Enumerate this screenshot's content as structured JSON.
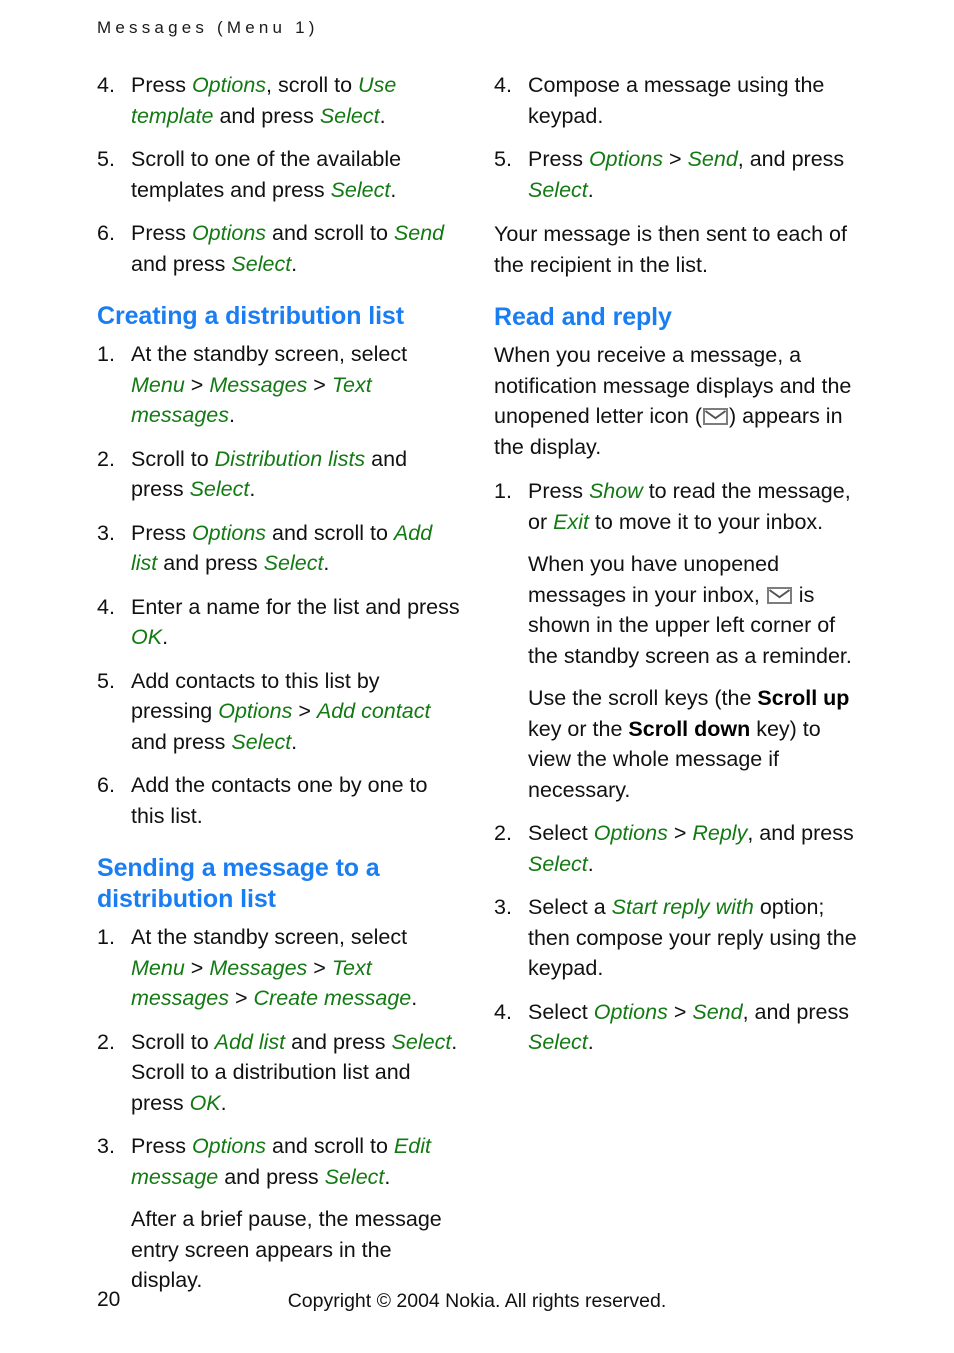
{
  "header": {
    "running_head": "Messages (Menu 1)"
  },
  "icons": {
    "envelope": "unopened-letter-icon"
  },
  "colors": {
    "heading_blue": "#1a7ef2",
    "ui_term_green": "#137a13",
    "body_black": "#111111",
    "icon_gray": "#808080"
  },
  "left_column": {
    "list_a": {
      "items": [
        {
          "num": "4.",
          "runs": [
            {
              "t": "Press ",
              "s": "plain"
            },
            {
              "t": "Options",
              "s": "ui"
            },
            {
              "t": ", scroll to ",
              "s": "plain"
            },
            {
              "t": "Use template",
              "s": "ui"
            },
            {
              "t": " and press ",
              "s": "plain"
            },
            {
              "t": "Select",
              "s": "ui"
            },
            {
              "t": ".",
              "s": "plain"
            }
          ]
        },
        {
          "num": "5.",
          "runs": [
            {
              "t": "Scroll to one of the available templates and press ",
              "s": "plain"
            },
            {
              "t": "Select",
              "s": "ui"
            },
            {
              "t": ".",
              "s": "plain"
            }
          ]
        },
        {
          "num": "6.",
          "runs": [
            {
              "t": "Press ",
              "s": "plain"
            },
            {
              "t": "Options",
              "s": "ui"
            },
            {
              "t": " and scroll to ",
              "s": "plain"
            },
            {
              "t": "Send",
              "s": "ui"
            },
            {
              "t": " and press ",
              "s": "plain"
            },
            {
              "t": "Select",
              "s": "ui"
            },
            {
              "t": ".",
              "s": "plain"
            }
          ]
        }
      ]
    },
    "heading_1": "Creating a distribution list",
    "list_b": {
      "items": [
        {
          "num": "1.",
          "runs": [
            {
              "t": "At the standby screen, select ",
              "s": "plain"
            },
            {
              "t": "Menu",
              "s": "ui"
            },
            {
              "t": " > ",
              "s": "gt"
            },
            {
              "t": "Messages",
              "s": "ui"
            },
            {
              "t": " > ",
              "s": "gt"
            },
            {
              "t": "Text messages",
              "s": "ui"
            },
            {
              "t": ".",
              "s": "plain"
            }
          ]
        },
        {
          "num": "2.",
          "runs": [
            {
              "t": "Scroll to ",
              "s": "plain"
            },
            {
              "t": "Distribution lists",
              "s": "ui"
            },
            {
              "t": " and press ",
              "s": "plain"
            },
            {
              "t": "Select",
              "s": "ui"
            },
            {
              "t": ".",
              "s": "plain"
            }
          ]
        },
        {
          "num": "3.",
          "runs": [
            {
              "t": "Press ",
              "s": "plain"
            },
            {
              "t": "Options",
              "s": "ui"
            },
            {
              "t": " and scroll to ",
              "s": "plain"
            },
            {
              "t": "Add list",
              "s": "ui"
            },
            {
              "t": " and press ",
              "s": "plain"
            },
            {
              "t": "Select",
              "s": "ui"
            },
            {
              "t": ".",
              "s": "plain"
            }
          ]
        },
        {
          "num": "4.",
          "runs": [
            {
              "t": "Enter a name for the list and press ",
              "s": "plain"
            },
            {
              "t": "OK",
              "s": "ui"
            },
            {
              "t": ".",
              "s": "plain"
            }
          ]
        },
        {
          "num": "5.",
          "runs": [
            {
              "t": "Add contacts to this list by pressing ",
              "s": "plain"
            },
            {
              "t": "Options",
              "s": "ui"
            },
            {
              "t": " > ",
              "s": "gt"
            },
            {
              "t": "Add contact",
              "s": "ui"
            },
            {
              "t": " and press ",
              "s": "plain"
            },
            {
              "t": "Select",
              "s": "ui"
            },
            {
              "t": ".",
              "s": "plain"
            }
          ]
        },
        {
          "num": "6.",
          "runs": [
            {
              "t": "Add the contacts one by one to this list.",
              "s": "plain"
            }
          ]
        }
      ]
    },
    "heading_2": "Sending a message to a distribution list",
    "list_c": {
      "items": [
        {
          "num": "1.",
          "runs": [
            {
              "t": "At the standby screen, select ",
              "s": "plain"
            },
            {
              "t": "Menu",
              "s": "ui"
            },
            {
              "t": " > ",
              "s": "gt"
            },
            {
              "t": "Messages",
              "s": "ui"
            },
            {
              "t": " > ",
              "s": "gt"
            },
            {
              "t": "Text messages",
              "s": "ui"
            },
            {
              "t": " > ",
              "s": "gt"
            },
            {
              "t": "Create message",
              "s": "ui"
            },
            {
              "t": ".",
              "s": "plain"
            }
          ]
        },
        {
          "num": "2.",
          "runs": [
            {
              "t": "Scroll to ",
              "s": "plain"
            },
            {
              "t": "Add list",
              "s": "ui"
            },
            {
              "t": " and press ",
              "s": "plain"
            },
            {
              "t": "Select",
              "s": "ui"
            },
            {
              "t": ". Scroll to a distribution list and press ",
              "s": "plain"
            },
            {
              "t": "OK",
              "s": "ui"
            },
            {
              "t": ".",
              "s": "plain"
            }
          ]
        },
        {
          "num": "3.",
          "runs": [
            {
              "t": "Press ",
              "s": "plain"
            },
            {
              "t": "Options",
              "s": "ui"
            },
            {
              "t": " and scroll to ",
              "s": "plain"
            },
            {
              "t": "Edit message",
              "s": "ui"
            },
            {
              "t": " and press ",
              "s": "plain"
            },
            {
              "t": "Select",
              "s": "ui"
            },
            {
              "t": ".",
              "s": "plain"
            }
          ],
          "sub": [
            {
              "t": "After a brief pause, the message entry screen appears in the display.",
              "s": "plain"
            }
          ]
        }
      ]
    }
  },
  "right_column": {
    "list_d": {
      "items": [
        {
          "num": "4.",
          "runs": [
            {
              "t": "Compose a message using the keypad.",
              "s": "plain"
            }
          ]
        },
        {
          "num": "5.",
          "runs": [
            {
              "t": "Press ",
              "s": "plain"
            },
            {
              "t": "Options",
              "s": "ui"
            },
            {
              "t": " > ",
              "s": "gt"
            },
            {
              "t": "Send",
              "s": "ui"
            },
            {
              "t": ", and press ",
              "s": "plain"
            },
            {
              "t": "Select",
              "s": "ui"
            },
            {
              "t": ".",
              "s": "plain"
            }
          ]
        }
      ]
    },
    "para_1": [
      {
        "t": "Your message is then sent to each of the recipient in the list.",
        "s": "plain"
      }
    ],
    "heading_1": "Read and reply",
    "para_2": [
      {
        "t": "When you receive a message, a notification message displays and the unopened letter icon (",
        "s": "plain"
      },
      {
        "t": "",
        "s": "envelope"
      },
      {
        "t": ") appears in the display.",
        "s": "plain"
      }
    ],
    "list_e": {
      "items": [
        {
          "num": "1.",
          "runs": [
            {
              "t": "Press ",
              "s": "plain"
            },
            {
              "t": "Show",
              "s": "ui"
            },
            {
              "t": " to read the message, or ",
              "s": "plain"
            },
            {
              "t": "Exit",
              "s": "ui"
            },
            {
              "t": " to move it to your inbox.",
              "s": "plain"
            }
          ],
          "sub": [
            {
              "t": "When you have unopened messages in your inbox, ",
              "s": "plain"
            },
            {
              "t": "",
              "s": "envelope"
            },
            {
              "t": " is shown in the upper left corner of the standby screen as a reminder.",
              "s": "plain"
            }
          ],
          "sub2": [
            {
              "t": "Use the scroll keys (the ",
              "s": "plain"
            },
            {
              "t": "Scroll up",
              "s": "kb"
            },
            {
              "t": " key or the ",
              "s": "plain"
            },
            {
              "t": "Scroll down",
              "s": "kb"
            },
            {
              "t": " key) to view the whole message if necessary.",
              "s": "plain"
            }
          ]
        },
        {
          "num": "2.",
          "runs": [
            {
              "t": "Select ",
              "s": "plain"
            },
            {
              "t": "Options",
              "s": "ui"
            },
            {
              "t": " > ",
              "s": "gt"
            },
            {
              "t": "Reply",
              "s": "ui"
            },
            {
              "t": ", and press ",
              "s": "plain"
            },
            {
              "t": "Select",
              "s": "ui"
            },
            {
              "t": ".",
              "s": "plain"
            }
          ]
        },
        {
          "num": "3.",
          "runs": [
            {
              "t": "Select a ",
              "s": "plain"
            },
            {
              "t": "Start reply with",
              "s": "ui"
            },
            {
              "t": " option; then compose your reply using the keypad.",
              "s": "plain"
            }
          ]
        },
        {
          "num": "4.",
          "runs": [
            {
              "t": "Select ",
              "s": "plain"
            },
            {
              "t": "Options",
              "s": "ui"
            },
            {
              "t": " > ",
              "s": "gt"
            },
            {
              "t": "Send",
              "s": "ui"
            },
            {
              "t": ", and press ",
              "s": "plain"
            },
            {
              "t": "Select",
              "s": "ui"
            },
            {
              "t": ".",
              "s": "plain"
            }
          ]
        }
      ]
    }
  },
  "footer": {
    "page_number": "20",
    "copyright": "Copyright © 2004 Nokia. All rights reserved."
  }
}
